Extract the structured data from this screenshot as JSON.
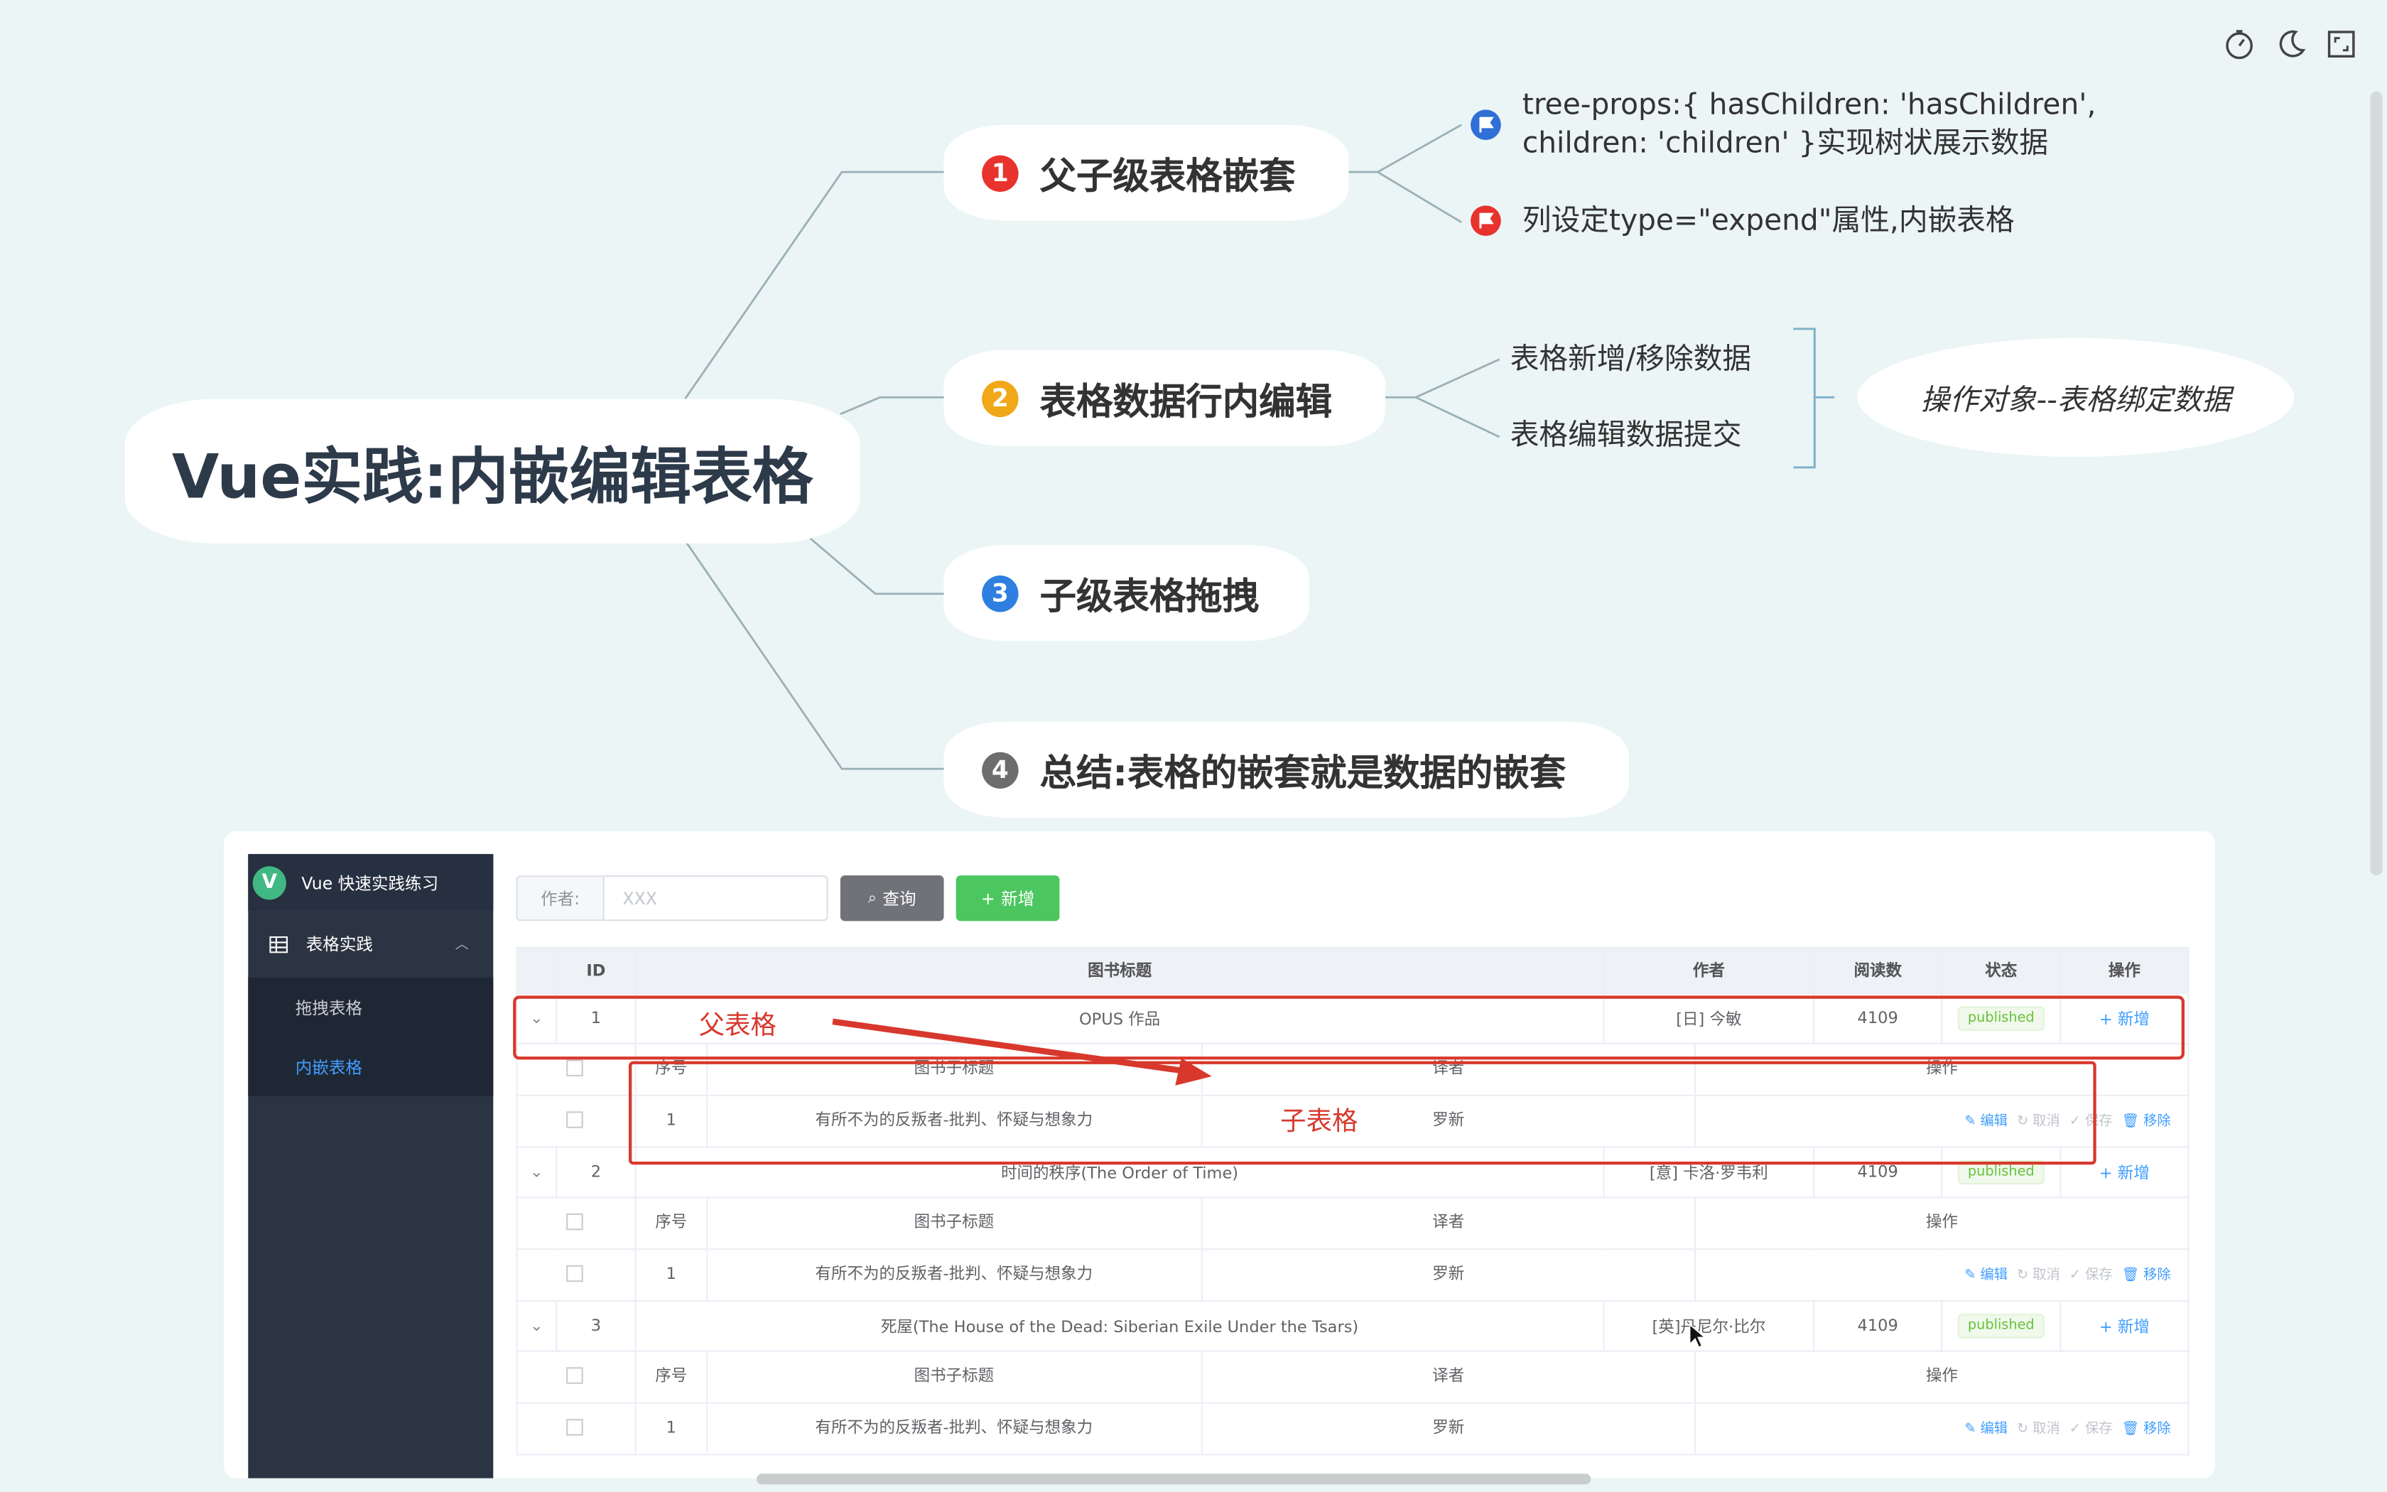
{
  "toolbar": {
    "icons": [
      "timer-icon",
      "moon-icon",
      "fullscreen-icon"
    ]
  },
  "mindmap": {
    "root": "Vue实践:内嵌编辑表格",
    "branches": [
      {
        "num": "1",
        "label": "父子级表格嵌套",
        "color": "#e8322d"
      },
      {
        "num": "2",
        "label": "表格数据行内编辑",
        "color": "#f0a819"
      },
      {
        "num": "3",
        "label": "子级表格拖拽",
        "color": "#2f7fe0"
      },
      {
        "num": "4",
        "label": "总结:表格的嵌套就是数据的嵌套",
        "color": "#6d6d6d"
      }
    ],
    "branch1_leaves": [
      "tree-props:{ hasChildren: 'hasChildren',",
      "children: 'children' }实现树状展示数据",
      "列设定type=\"expend\"属性,内嵌表格"
    ],
    "branch2_leaves": [
      "表格新增/移除数据",
      "表格编辑数据提交"
    ],
    "branch2_summary": "操作对象--表格绑定数据"
  },
  "app": {
    "brand": "Vue 快速实践练习",
    "logo_letter": "V",
    "menu_group": "表格实践",
    "menu_items": [
      "拖拽表格",
      "内嵌表格"
    ],
    "search_label": "作者:",
    "search_placeholder": "XXX",
    "query_button": "查询",
    "add_button": "新增",
    "headers": [
      "ID",
      "图书标题",
      "作者",
      "阅读数",
      "状态",
      "操作"
    ],
    "sub_headers": [
      "序号",
      "图书子标题",
      "译者",
      "操作"
    ],
    "rows": [
      {
        "id": "1",
        "title": "OPUS 作品",
        "author": "[日] 今敏",
        "reads": "4109",
        "status": "published",
        "op": "新增",
        "child": {
          "no": "1",
          "subtitle": "有所不为的反叛者-批判、怀疑与想象力",
          "translator": "罗新"
        }
      },
      {
        "id": "2",
        "title": "时间的秩序(The Order of Time)",
        "author": "[意] 卡洛·罗韦利",
        "reads": "4109",
        "status": "published",
        "op": "新增",
        "child": {
          "no": "1",
          "subtitle": "有所不为的反叛者-批判、怀疑与想象力",
          "translator": "罗新"
        }
      },
      {
        "id": "3",
        "title": "死屋(The House of the Dead: Siberian Exile Under the Tsars)",
        "author": "[英]丹尼尔·比尔",
        "reads": "4109",
        "status": "published",
        "op": "新增",
        "child": {
          "no": "1",
          "subtitle": "有所不为的反叛者-批判、怀疑与想象力",
          "translator": "罗新"
        }
      }
    ],
    "child_ops": [
      "编辑",
      "取消",
      "保存",
      "移除"
    ],
    "annotation_parent": "父表格",
    "annotation_child": "子表格"
  }
}
